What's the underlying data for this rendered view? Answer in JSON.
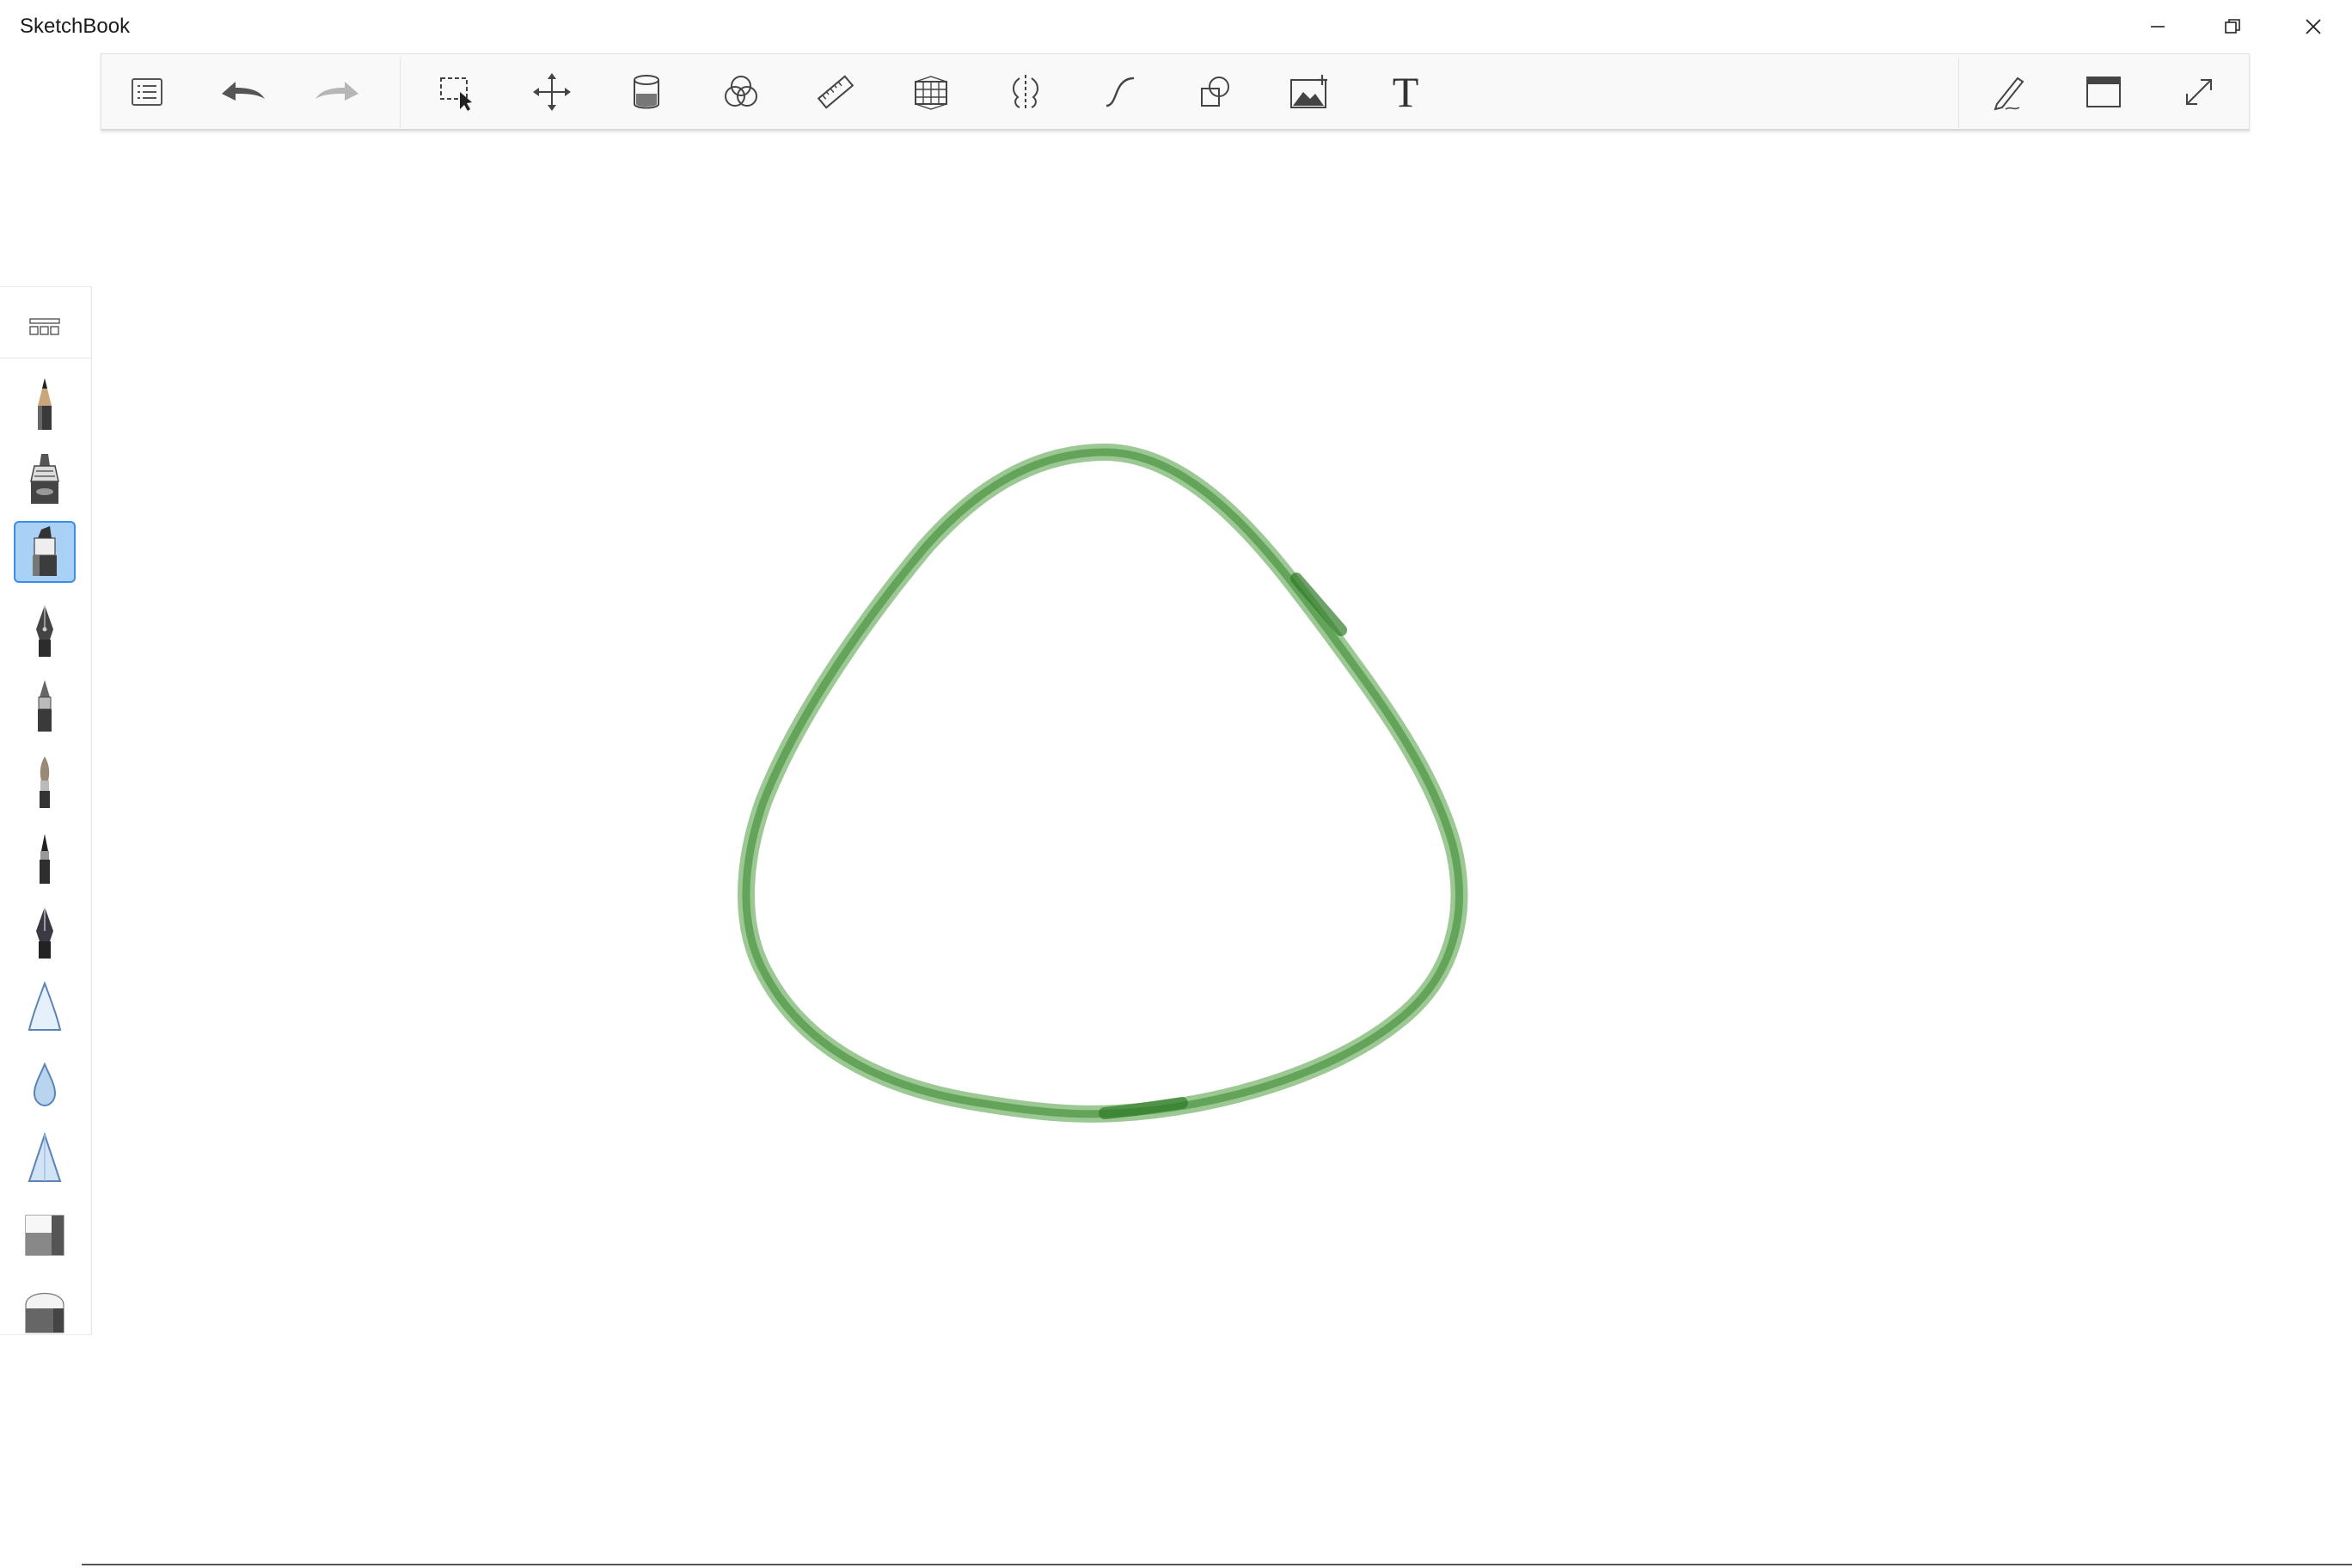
{
  "window": {
    "title": "SketchBook"
  },
  "toolbar": {
    "items": [
      {
        "id": "layer-list",
        "icon": "list-icon"
      },
      {
        "id": "undo",
        "icon": "undo-icon"
      },
      {
        "id": "redo",
        "icon": "redo-icon"
      },
      {
        "id": "select",
        "icon": "selection-icon"
      },
      {
        "id": "transform",
        "icon": "move-icon"
      },
      {
        "id": "fill",
        "icon": "paint-bucket-icon"
      },
      {
        "id": "color-editor",
        "icon": "color-circles-icon"
      },
      {
        "id": "ruler",
        "icon": "ruler-icon"
      },
      {
        "id": "perspective",
        "icon": "perspective-grid-icon"
      },
      {
        "id": "symmetry",
        "icon": "symmetry-icon"
      },
      {
        "id": "stroke",
        "icon": "curve-icon"
      },
      {
        "id": "shapes",
        "icon": "shapes-icon"
      },
      {
        "id": "import-image",
        "icon": "image-add-icon"
      },
      {
        "id": "text",
        "icon": "text-icon",
        "label": "T"
      },
      {
        "id": "pen-mode",
        "icon": "pen-icon"
      },
      {
        "id": "ui-toggle",
        "icon": "window-icon"
      },
      {
        "id": "fullscreen",
        "icon": "expand-icon"
      }
    ]
  },
  "brush_palette": {
    "selected_index": 2,
    "items": [
      {
        "id": "pencil",
        "icon": "pencil-icon"
      },
      {
        "id": "airbrush",
        "icon": "airbrush-icon"
      },
      {
        "id": "marker",
        "icon": "marker-icon"
      },
      {
        "id": "ink-pen",
        "icon": "ink-pen-icon"
      },
      {
        "id": "ballpoint",
        "icon": "ballpoint-pen-icon"
      },
      {
        "id": "paintbrush",
        "icon": "paintbrush-icon"
      },
      {
        "id": "fine-liner",
        "icon": "fine-liner-icon"
      },
      {
        "id": "calligraphy",
        "icon": "calligraphy-pen-icon"
      },
      {
        "id": "smudge",
        "icon": "smudge-icon"
      },
      {
        "id": "blur",
        "icon": "water-drop-icon"
      },
      {
        "id": "sharpen",
        "icon": "triangle-icon"
      },
      {
        "id": "hard-eraser",
        "icon": "eraser-icon"
      },
      {
        "id": "soft-eraser",
        "icon": "soft-eraser-icon"
      }
    ]
  },
  "canvas": {
    "stroke_color": "#4a9a3c",
    "stroke_shape": "rounded-triangle loop"
  }
}
